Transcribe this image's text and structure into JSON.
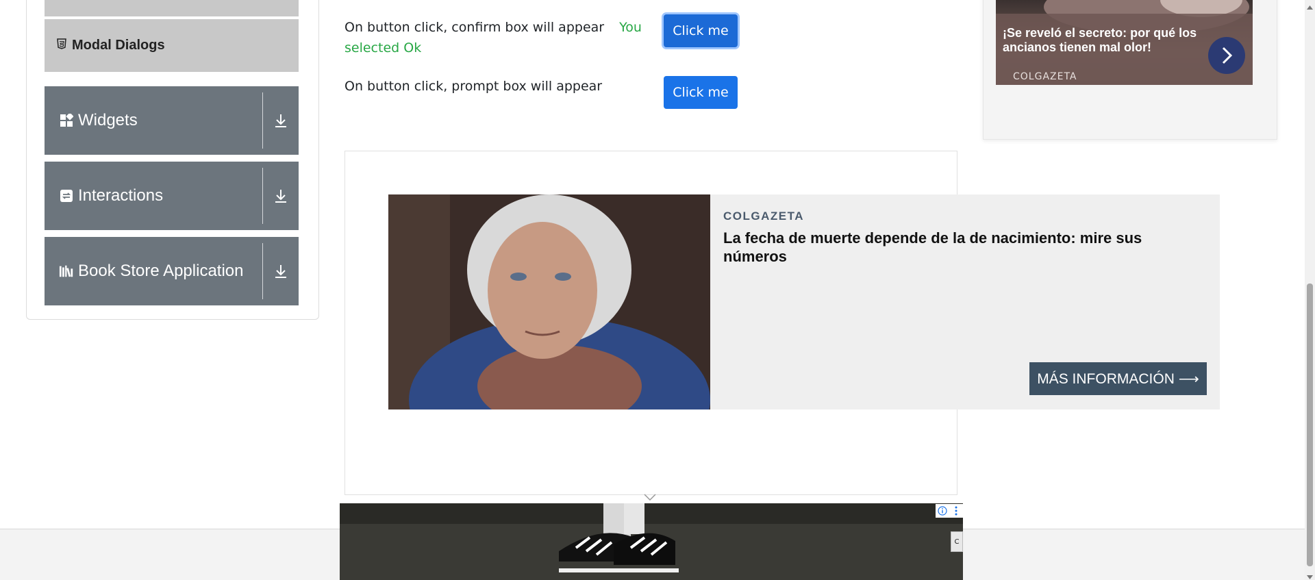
{
  "sidebar": {
    "active_item": {
      "label": "Modal Dialogs",
      "icon": "html5-icon"
    },
    "groups": [
      {
        "label": "Widgets",
        "icon": "widgets-icon"
      },
      {
        "label": "Interactions",
        "icon": "interactions-icon"
      },
      {
        "label": "Book Store Application",
        "icon": "book-store-icon"
      }
    ]
  },
  "alerts": {
    "confirm": {
      "text": "On button click, confirm box will appear",
      "result": "You selected Ok",
      "button": "Click me"
    },
    "prompt": {
      "text": "On button click, prompt box will appear",
      "button": "Click me"
    }
  },
  "ad_right": {
    "headline": "¡Se reveló el secreto: por qué los ancianos tienen mal olor!",
    "brand": "COLGAZETA"
  },
  "ad_main": {
    "brand": "COLGAZETA",
    "headline": "La fecha de muerte depende de la de nacimiento: mire sus números",
    "cta": "MÁS INFORMACIÓN ⟶"
  },
  "bottom_ad": {
    "close_tab": "C"
  },
  "colors": {
    "button_primary": "#1a73e8",
    "sidebar_group": "#6c757d",
    "success_text": "#28a745",
    "cta_bg": "#3d5163"
  }
}
